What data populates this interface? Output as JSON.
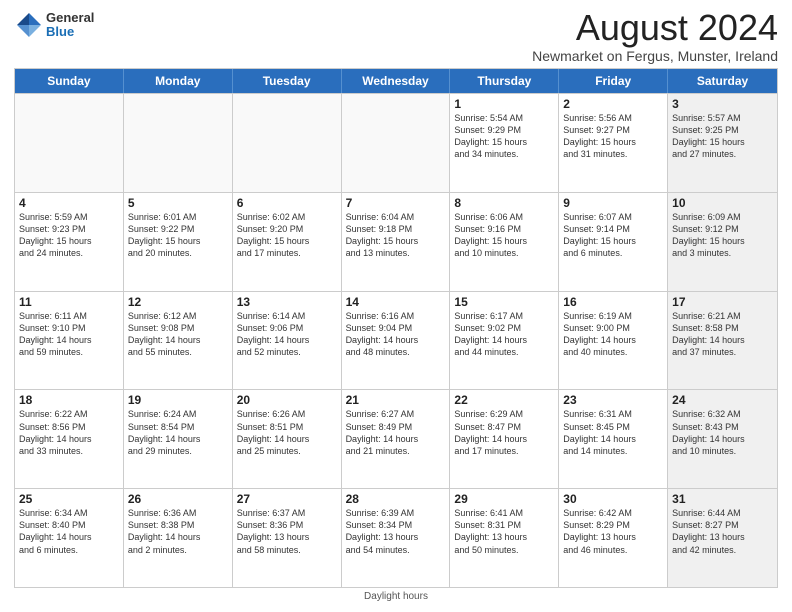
{
  "header": {
    "logo_general": "General",
    "logo_blue": "Blue",
    "month_title": "August 2024",
    "location": "Newmarket on Fergus, Munster, Ireland"
  },
  "days_of_week": [
    "Sunday",
    "Monday",
    "Tuesday",
    "Wednesday",
    "Thursday",
    "Friday",
    "Saturday"
  ],
  "weeks": [
    [
      {
        "day": "",
        "content": "",
        "empty": true
      },
      {
        "day": "",
        "content": "",
        "empty": true
      },
      {
        "day": "",
        "content": "",
        "empty": true
      },
      {
        "day": "",
        "content": "",
        "empty": true
      },
      {
        "day": "1",
        "content": "Sunrise: 5:54 AM\nSunset: 9:29 PM\nDaylight: 15 hours\nand 34 minutes.",
        "empty": false
      },
      {
        "day": "2",
        "content": "Sunrise: 5:56 AM\nSunset: 9:27 PM\nDaylight: 15 hours\nand 31 minutes.",
        "empty": false
      },
      {
        "day": "3",
        "content": "Sunrise: 5:57 AM\nSunset: 9:25 PM\nDaylight: 15 hours\nand 27 minutes.",
        "empty": false,
        "shaded": true
      }
    ],
    [
      {
        "day": "4",
        "content": "Sunrise: 5:59 AM\nSunset: 9:23 PM\nDaylight: 15 hours\nand 24 minutes.",
        "empty": false
      },
      {
        "day": "5",
        "content": "Sunrise: 6:01 AM\nSunset: 9:22 PM\nDaylight: 15 hours\nand 20 minutes.",
        "empty": false
      },
      {
        "day": "6",
        "content": "Sunrise: 6:02 AM\nSunset: 9:20 PM\nDaylight: 15 hours\nand 17 minutes.",
        "empty": false
      },
      {
        "day": "7",
        "content": "Sunrise: 6:04 AM\nSunset: 9:18 PM\nDaylight: 15 hours\nand 13 minutes.",
        "empty": false
      },
      {
        "day": "8",
        "content": "Sunrise: 6:06 AM\nSunset: 9:16 PM\nDaylight: 15 hours\nand 10 minutes.",
        "empty": false
      },
      {
        "day": "9",
        "content": "Sunrise: 6:07 AM\nSunset: 9:14 PM\nDaylight: 15 hours\nand 6 minutes.",
        "empty": false
      },
      {
        "day": "10",
        "content": "Sunrise: 6:09 AM\nSunset: 9:12 PM\nDaylight: 15 hours\nand 3 minutes.",
        "empty": false,
        "shaded": true
      }
    ],
    [
      {
        "day": "11",
        "content": "Sunrise: 6:11 AM\nSunset: 9:10 PM\nDaylight: 14 hours\nand 59 minutes.",
        "empty": false
      },
      {
        "day": "12",
        "content": "Sunrise: 6:12 AM\nSunset: 9:08 PM\nDaylight: 14 hours\nand 55 minutes.",
        "empty": false
      },
      {
        "day": "13",
        "content": "Sunrise: 6:14 AM\nSunset: 9:06 PM\nDaylight: 14 hours\nand 52 minutes.",
        "empty": false
      },
      {
        "day": "14",
        "content": "Sunrise: 6:16 AM\nSunset: 9:04 PM\nDaylight: 14 hours\nand 48 minutes.",
        "empty": false
      },
      {
        "day": "15",
        "content": "Sunrise: 6:17 AM\nSunset: 9:02 PM\nDaylight: 14 hours\nand 44 minutes.",
        "empty": false
      },
      {
        "day": "16",
        "content": "Sunrise: 6:19 AM\nSunset: 9:00 PM\nDaylight: 14 hours\nand 40 minutes.",
        "empty": false
      },
      {
        "day": "17",
        "content": "Sunrise: 6:21 AM\nSunset: 8:58 PM\nDaylight: 14 hours\nand 37 minutes.",
        "empty": false,
        "shaded": true
      }
    ],
    [
      {
        "day": "18",
        "content": "Sunrise: 6:22 AM\nSunset: 8:56 PM\nDaylight: 14 hours\nand 33 minutes.",
        "empty": false
      },
      {
        "day": "19",
        "content": "Sunrise: 6:24 AM\nSunset: 8:54 PM\nDaylight: 14 hours\nand 29 minutes.",
        "empty": false
      },
      {
        "day": "20",
        "content": "Sunrise: 6:26 AM\nSunset: 8:51 PM\nDaylight: 14 hours\nand 25 minutes.",
        "empty": false
      },
      {
        "day": "21",
        "content": "Sunrise: 6:27 AM\nSunset: 8:49 PM\nDaylight: 14 hours\nand 21 minutes.",
        "empty": false
      },
      {
        "day": "22",
        "content": "Sunrise: 6:29 AM\nSunset: 8:47 PM\nDaylight: 14 hours\nand 17 minutes.",
        "empty": false
      },
      {
        "day": "23",
        "content": "Sunrise: 6:31 AM\nSunset: 8:45 PM\nDaylight: 14 hours\nand 14 minutes.",
        "empty": false
      },
      {
        "day": "24",
        "content": "Sunrise: 6:32 AM\nSunset: 8:43 PM\nDaylight: 14 hours\nand 10 minutes.",
        "empty": false,
        "shaded": true
      }
    ],
    [
      {
        "day": "25",
        "content": "Sunrise: 6:34 AM\nSunset: 8:40 PM\nDaylight: 14 hours\nand 6 minutes.",
        "empty": false
      },
      {
        "day": "26",
        "content": "Sunrise: 6:36 AM\nSunset: 8:38 PM\nDaylight: 14 hours\nand 2 minutes.",
        "empty": false
      },
      {
        "day": "27",
        "content": "Sunrise: 6:37 AM\nSunset: 8:36 PM\nDaylight: 13 hours\nand 58 minutes.",
        "empty": false
      },
      {
        "day": "28",
        "content": "Sunrise: 6:39 AM\nSunset: 8:34 PM\nDaylight: 13 hours\nand 54 minutes.",
        "empty": false
      },
      {
        "day": "29",
        "content": "Sunrise: 6:41 AM\nSunset: 8:31 PM\nDaylight: 13 hours\nand 50 minutes.",
        "empty": false
      },
      {
        "day": "30",
        "content": "Sunrise: 6:42 AM\nSunset: 8:29 PM\nDaylight: 13 hours\nand 46 minutes.",
        "empty": false
      },
      {
        "day": "31",
        "content": "Sunrise: 6:44 AM\nSunset: 8:27 PM\nDaylight: 13 hours\nand 42 minutes.",
        "empty": false,
        "shaded": true
      }
    ]
  ],
  "footer": "Daylight hours"
}
